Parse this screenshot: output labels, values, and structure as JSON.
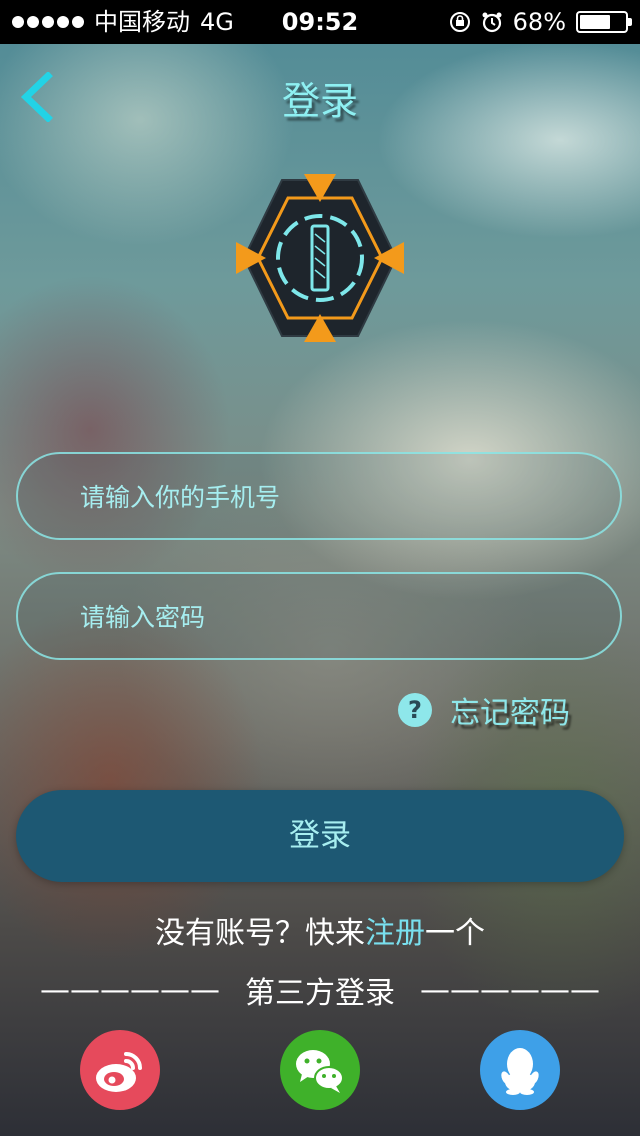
{
  "status_bar": {
    "carrier": "中国移动",
    "network": "4G",
    "time": "09:52",
    "battery_text": "68%",
    "battery_level": 0.68,
    "icons": [
      "signal-dots-icon",
      "orientation-lock-icon",
      "alarm-icon",
      "battery-icon"
    ]
  },
  "header": {
    "title": "登录",
    "back_icon": "chevron-left-icon"
  },
  "logo": {
    "icon": "hexagon-target-logo-icon"
  },
  "form": {
    "phone_placeholder": "请输入你的手机号",
    "password_placeholder": "请输入密码",
    "phone_value": "",
    "password_value": "",
    "forgot_icon": "question-icon",
    "forgot_label": "忘记密码",
    "login_label": "登录"
  },
  "register": {
    "prefix": "没有账号？快来",
    "link": "注册",
    "suffix": "一个"
  },
  "third_party": {
    "dashes_left": "——————",
    "label": "第三方登录",
    "dashes_right": "——————",
    "providers": [
      {
        "name": "weibo",
        "icon": "weibo-icon",
        "color": "#e64a5c"
      },
      {
        "name": "wechat",
        "icon": "wechat-icon",
        "color": "#3fb12a"
      },
      {
        "name": "qq",
        "icon": "qq-icon",
        "color": "#3ea0e8"
      }
    ]
  },
  "colors": {
    "accent": "#8ee7ea",
    "button": "#1d5873",
    "logo_orange": "#f39a1b"
  }
}
